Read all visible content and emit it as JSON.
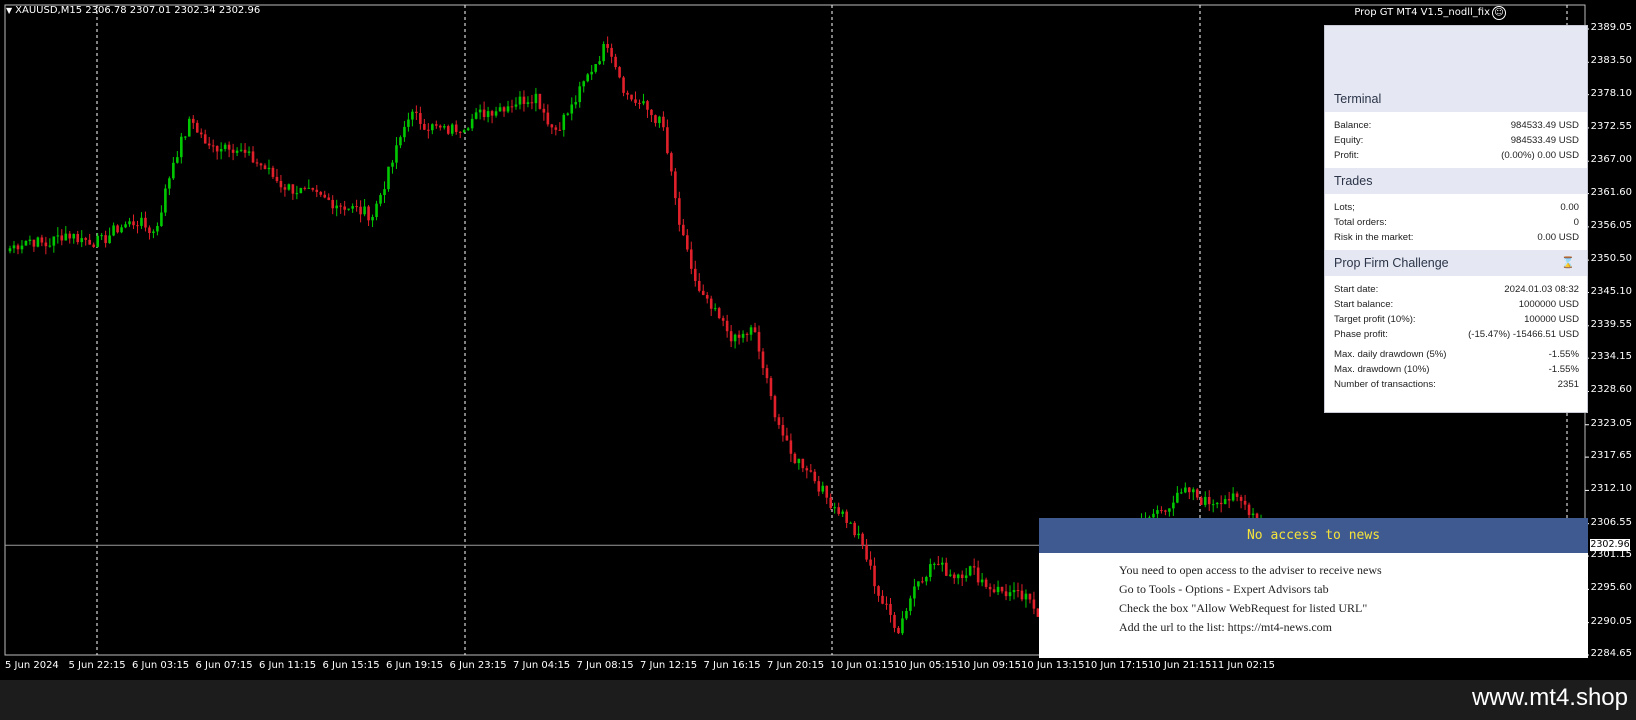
{
  "header": {
    "symbol_line": "XAUUSD,M15  2306.78 2307.01 2302.34 2302.96",
    "ea_name": "Prop GT MT4 V1.5_nodll_fix",
    "smiley_glyph": "☺"
  },
  "colors": {
    "bull": "#00c800",
    "bear": "#e0202a",
    "background": "#000000",
    "grid": "#ffffff",
    "news_title_bg": "#3f5a91",
    "news_title_text": "#f5e33a"
  },
  "price_axis": {
    "labels": [
      "2389.05",
      "2383.50",
      "2378.10",
      "2372.55",
      "2367.00",
      "2361.60",
      "2356.05",
      "2350.50",
      "2345.10",
      "2339.55",
      "2334.15",
      "2328.60",
      "2323.05",
      "2317.65",
      "2312.10",
      "2306.55",
      "2301.15",
      "2295.60",
      "2290.05",
      "2284.65"
    ],
    "current_price": "2302.96"
  },
  "time_axis": {
    "labels": [
      "5 Jun 2024",
      "5 Jun 22:15",
      "6 Jun 03:15",
      "6 Jun 07:15",
      "6 Jun 11:15",
      "6 Jun 15:15",
      "6 Jun 19:15",
      "6 Jun 23:15",
      "7 Jun 04:15",
      "7 Jun 08:15",
      "7 Jun 12:15",
      "7 Jun 16:15",
      "7 Jun 20:15",
      "10 Jun 01:15",
      "10 Jun 05:15",
      "10 Jun 09:15",
      "10 Jun 13:15",
      "10 Jun 17:15",
      "10 Jun 21:15",
      "11 Jun 02:15"
    ]
  },
  "chart_data": {
    "type": "candlestick",
    "symbol": "XAUUSD",
    "timeframe": "M15",
    "ylim": [
      2284.65,
      2389.05
    ],
    "current_price": 2302.96,
    "anchor_closes": [
      2352.5,
      2354,
      2353,
      2355,
      2354,
      2353.5,
      2356,
      2357,
      2355,
      2367,
      2374,
      2369,
      2370,
      2368,
      2366,
      2363,
      2362,
      2361,
      2360,
      2359,
      2358,
      2366,
      2375,
      2373,
      2372,
      2373,
      2375,
      2376,
      2377,
      2378,
      2372,
      2376,
      2382,
      2387,
      2378,
      2376,
      2373,
      2355,
      2345,
      2341,
      2337,
      2339,
      2327,
      2318,
      2316,
      2311,
      2308,
      2303,
      2294,
      2289,
      2297,
      2300,
      2298,
      2299,
      2296,
      2295,
      2294,
      2291,
      2297,
      2299,
      2300,
      2302,
      2305,
      2308,
      2310,
      2312,
      2310,
      2311,
      2310,
      2307
    ],
    "gap_after_index": 52
  },
  "info_panel": {
    "sections": [
      {
        "title": "Terminal",
        "rows": [
          {
            "label": "Balance:",
            "value": "984533.49 USD"
          },
          {
            "label": "Equity:",
            "value": "984533.49 USD"
          },
          {
            "label": "Profit:",
            "value": "(0.00%) 0.00 USD"
          }
        ]
      },
      {
        "title": "Trades",
        "rows": [
          {
            "label": "Lots;",
            "value": "0.00"
          },
          {
            "label": "Total orders:",
            "value": "0"
          },
          {
            "label": "Risk in the market:",
            "value": "0.00 USD"
          }
        ]
      },
      {
        "title": "Prop Firm Challenge",
        "icon": "hourglass-icon",
        "icon_glyph": "⌛",
        "rows": [
          {
            "label": "Start date:",
            "value": "2024.01.03 08:32"
          },
          {
            "label": "Start balance:",
            "value": "1000000 USD"
          },
          {
            "label": "Target profit (10%):",
            "value": "100000 USD"
          },
          {
            "label": "Phase profit:",
            "value": "(-15.47%) -15466.51 USD"
          }
        ],
        "rows2": [
          {
            "label": "Max. daily drawdown (5%)",
            "value": "-1.55%"
          },
          {
            "label": "Max. drawdown (10%)",
            "value": "-1.55%"
          },
          {
            "label": "Number of transactions:",
            "value": "2351"
          }
        ]
      }
    ]
  },
  "news_panel": {
    "title": "No access to news",
    "lines": [
      "You need to open access to the adviser to receive news",
      "Go to Tools - Options - Expert Advisors tab",
      "Check the box \"Allow WebRequest for listed URL\"",
      "Add the url to the list: https://mt4-news.com"
    ]
  },
  "watermark": "www.mt4.shop"
}
